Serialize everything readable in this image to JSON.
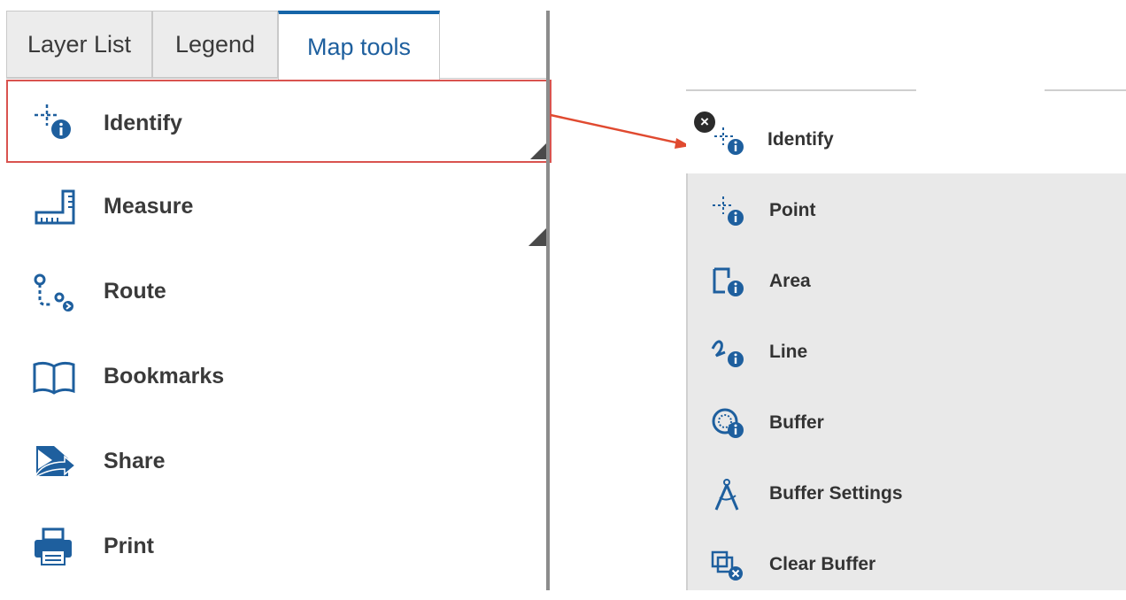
{
  "tabs": [
    {
      "label": "Layer List",
      "active": false
    },
    {
      "label": "Legend",
      "active": false
    },
    {
      "label": "Map tools",
      "active": true
    }
  ],
  "map_tools": [
    {
      "label": "Identify",
      "icon": "identify-icon",
      "selected": true
    },
    {
      "label": "Measure",
      "icon": "ruler-icon"
    },
    {
      "label": "Route",
      "icon": "route-icon"
    },
    {
      "label": "Bookmarks",
      "icon": "book-icon"
    },
    {
      "label": "Share",
      "icon": "share-icon"
    },
    {
      "label": "Print",
      "icon": "printer-icon"
    }
  ],
  "identify_popup": {
    "header_label": "Identify",
    "items": [
      {
        "label": "Point",
        "icon": "identify-point-icon"
      },
      {
        "label": "Area",
        "icon": "identify-area-icon"
      },
      {
        "label": "Line",
        "icon": "identify-line-icon"
      },
      {
        "label": "Buffer",
        "icon": "identify-buffer-icon"
      },
      {
        "label": "Buffer Settings",
        "icon": "compass-icon"
      },
      {
        "label": "Clear Buffer",
        "icon": "clear-buffer-icon"
      }
    ]
  },
  "colors": {
    "accent": "#1565a8",
    "highlight": "#d9534f",
    "icon_blue": "#1e5f9e"
  }
}
